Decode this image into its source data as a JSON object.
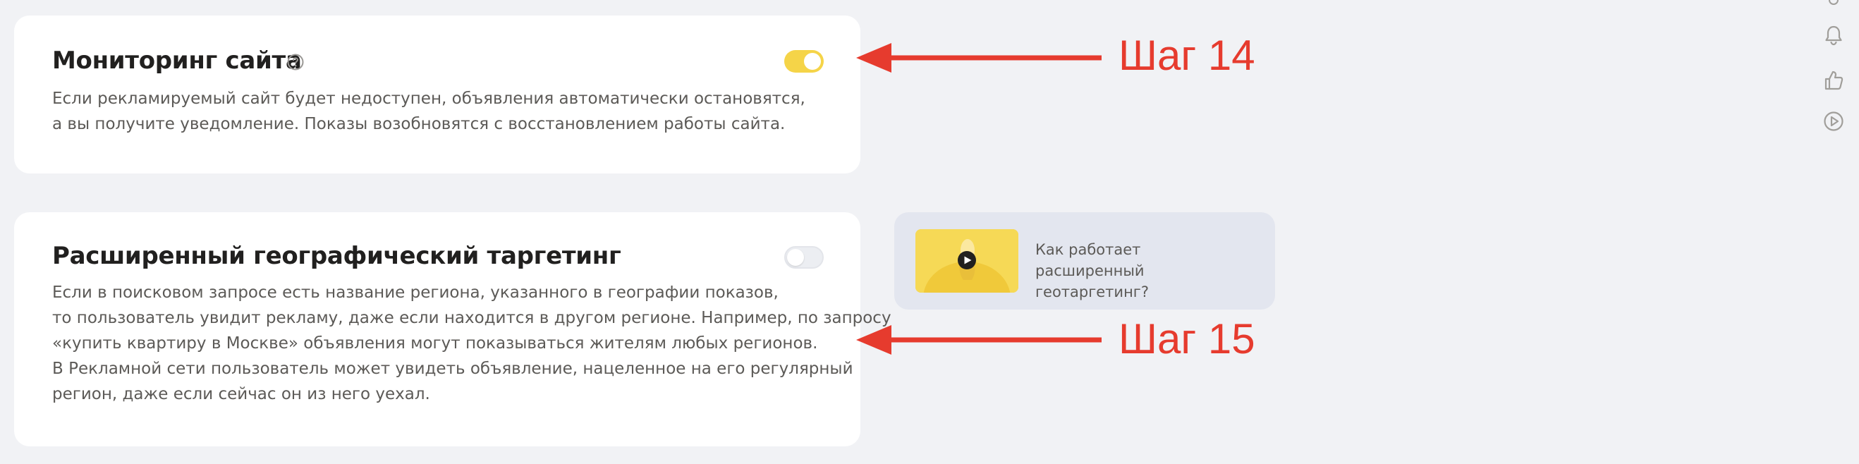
{
  "settings": [
    {
      "title": "Мониторинг сайта",
      "has_help_icon": true,
      "toggle_on": true,
      "description_lines": [
        "Если рекламируемый сайт будет недоступен, объявления автоматически остановятся,",
        "а вы получите уведомление. Показы возобновятся с восстановлением работы сайта."
      ]
    },
    {
      "title": "Расширенный географический таргетинг",
      "toggle_on": false,
      "description_lines": [
        "Если в поисковом запросе есть название региона, указанного в географии показов,",
        "то пользователь увидит рекламу, даже если находится в другом регионе. Например, по запросу",
        "«купить квартиру в Москве» объявления могут показываться жителям любых регионов.",
        "В Рекламной сети пользователь может увидеть объявление, нацеленное на его регулярный",
        "регион, даже если сейчас он из него уехал."
      ]
    }
  ],
  "video_card": {
    "title": "Как работает расширенный геотаргетинг?",
    "icon": "play-icon"
  },
  "annotations": [
    {
      "label": "Шаг 14"
    },
    {
      "label": "Шаг 15"
    }
  ],
  "side_icons": [
    "bell-icon",
    "thumbs-up-icon",
    "play-circle-icon"
  ],
  "colors": {
    "accent_yellow": "#f5d448",
    "annotation_red": "#e63b2e",
    "background": "#f1f2f5"
  }
}
